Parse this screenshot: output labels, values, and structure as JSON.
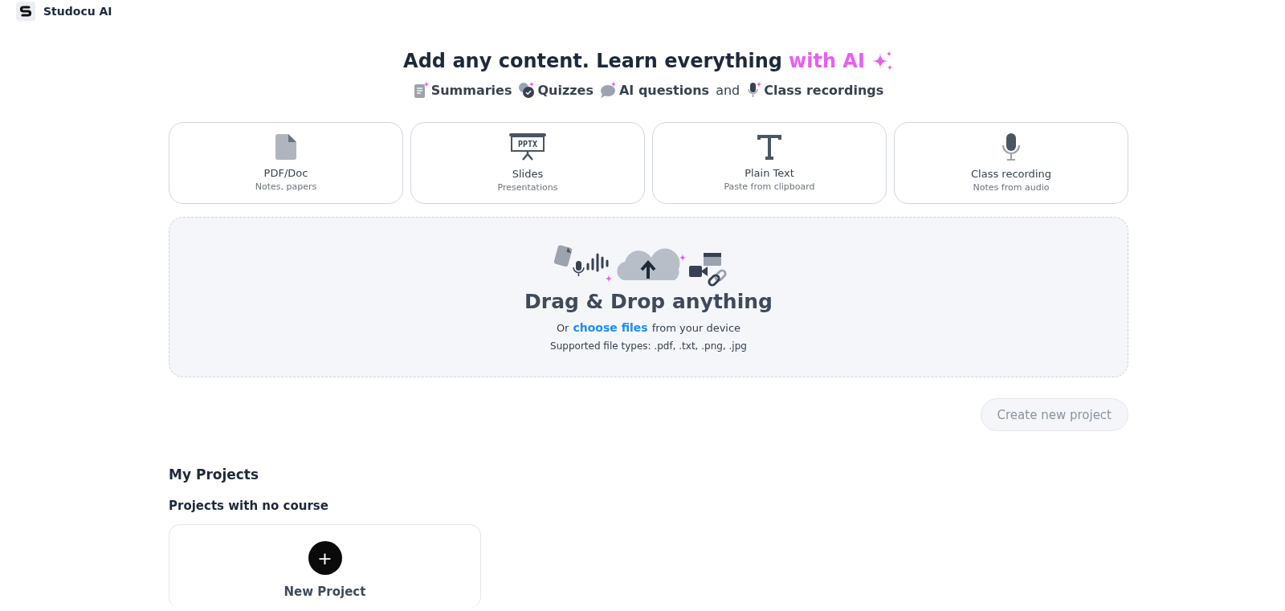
{
  "header": {
    "brand": "Studocu AI"
  },
  "hero": {
    "title": "Add any content. Learn everything",
    "title_highlight": "with AI",
    "features": [
      {
        "kind": "summary",
        "label": "Summaries"
      },
      {
        "kind": "quiz",
        "label": "Quizzes"
      },
      {
        "kind": "chat",
        "label": "AI questions"
      },
      {
        "kind": "text",
        "label": "and"
      },
      {
        "kind": "mic",
        "label": "Class recordings"
      }
    ]
  },
  "sources": [
    {
      "kind": "file",
      "title": "PDF/Doc",
      "subtitle": "Notes, papers"
    },
    {
      "kind": "slides",
      "title": "Slides",
      "subtitle": "Presentations",
      "icon_text": "PPTX"
    },
    {
      "kind": "text",
      "title": "Plain Text",
      "subtitle": "Paste from clipboard"
    },
    {
      "kind": "mic",
      "title": "Class recording",
      "subtitle": "Notes from audio"
    }
  ],
  "dropzone": {
    "title": "Drag & Drop anything",
    "line_before": "Or",
    "link": "choose files",
    "line_after": "from your device",
    "supported": "Supported file types: .pdf, .txt, .png, .jpg"
  },
  "create_button": {
    "label": "Create new project",
    "disabled": true
  },
  "projects": {
    "title": "My Projects",
    "group": "Projects with no course",
    "new_card": {
      "label": "New Project",
      "plus": "+"
    }
  }
}
